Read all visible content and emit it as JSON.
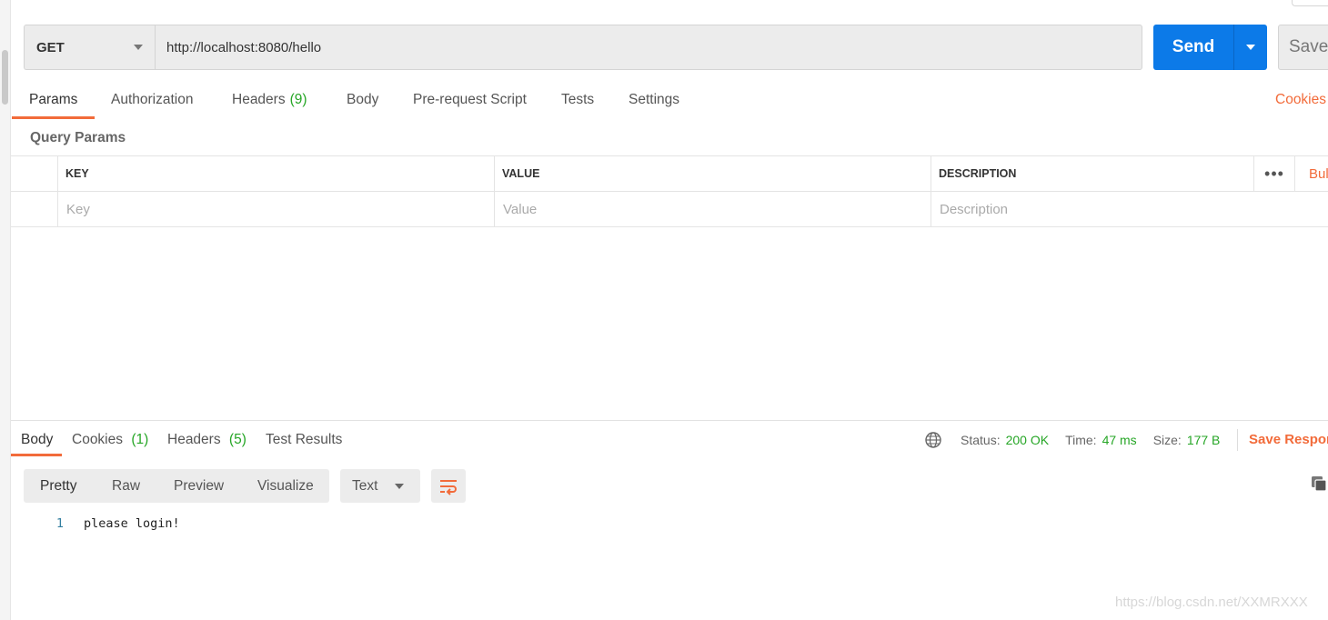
{
  "request": {
    "method": "GET",
    "url": "http://localhost:8080/hello",
    "send_label": "Send",
    "save_label": "Save"
  },
  "request_tabs": [
    {
      "label": "Params",
      "active": true
    },
    {
      "label": "Authorization"
    },
    {
      "label": "Headers",
      "count": "(9)"
    },
    {
      "label": "Body"
    },
    {
      "label": "Pre-request Script"
    },
    {
      "label": "Tests"
    },
    {
      "label": "Settings"
    }
  ],
  "cookies_link": "Cookies",
  "params": {
    "title": "Query Params",
    "headers": {
      "key": "KEY",
      "value": "VALUE",
      "description": "DESCRIPTION"
    },
    "placeholders": {
      "key": "Key",
      "value": "Value",
      "description": "Description"
    },
    "more_label": "•••",
    "bulk_edit_label": "Bulk Edit"
  },
  "response_tabs": [
    {
      "label": "Body",
      "active": true
    },
    {
      "label": "Cookies",
      "count": "(1)"
    },
    {
      "label": "Headers",
      "count": "(5)"
    },
    {
      "label": "Test Results"
    }
  ],
  "status": {
    "status_label": "Status:",
    "status_value": "200 OK",
    "time_label": "Time:",
    "time_value": "47 ms",
    "size_label": "Size:",
    "size_value": "177 B",
    "save_response_label": "Save Response"
  },
  "view_modes": [
    {
      "label": "Pretty",
      "active": true
    },
    {
      "label": "Raw"
    },
    {
      "label": "Preview"
    },
    {
      "label": "Visualize"
    }
  ],
  "format": "Text",
  "response_body": [
    {
      "line": "1",
      "text": "please login!"
    }
  ],
  "watermark": "https://blog.csdn.net/XXMRXXX",
  "colors": {
    "accent": "#f26b3a",
    "send": "#0c7ae8",
    "success": "#26a626"
  }
}
